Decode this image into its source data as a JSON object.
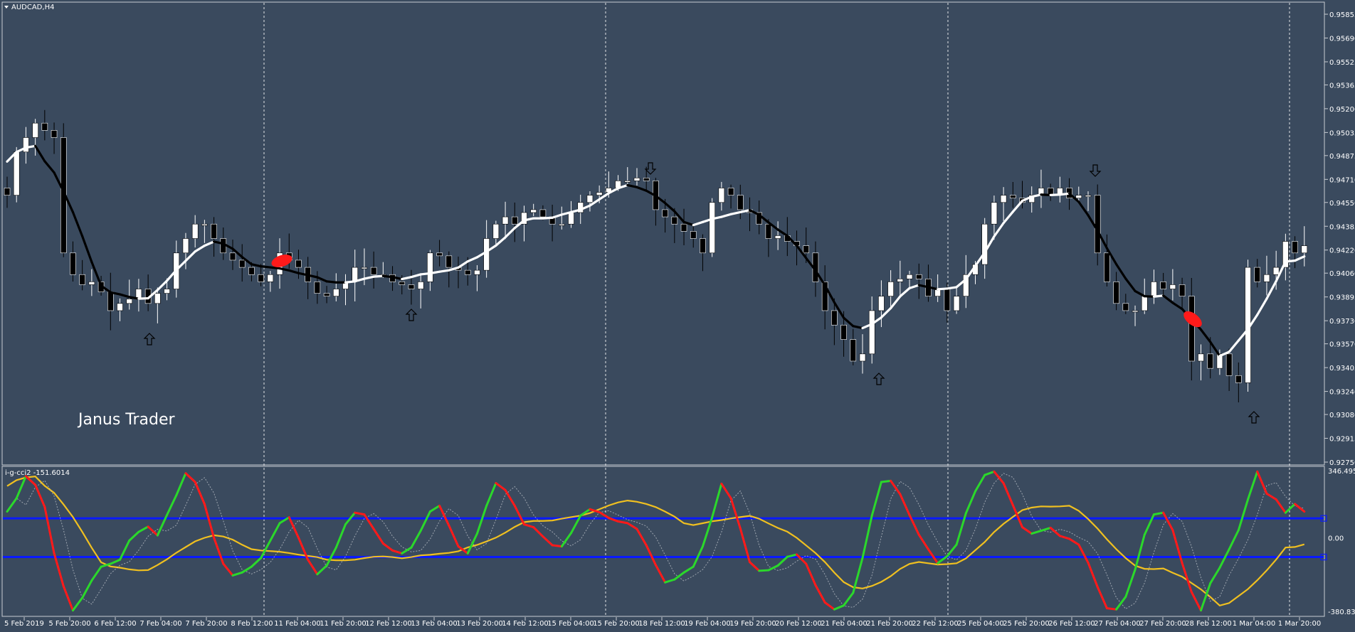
{
  "window": {
    "symbol_label": "AUDCAD,H4",
    "watermark": "Janus Trader",
    "indicator_label": "i-g-cci2 -151.6014"
  },
  "price_axis": {
    "labels": [
      "0.95855",
      "0.95690",
      "0.95525",
      "0.95365",
      "0.95200",
      "0.95035",
      "0.94875",
      "0.94710",
      "0.94550",
      "0.94385",
      "0.94220",
      "0.94060",
      "0.93895",
      "0.93730",
      "0.93570",
      "0.93405",
      "0.93240",
      "0.93080",
      "0.92915",
      "0.92750"
    ]
  },
  "indicator_axis": {
    "labels": [
      "346.4955",
      "0.00",
      "-380.8338"
    ]
  },
  "time_axis": {
    "labels": [
      "5 Feb 2019",
      "5 Feb 20:00",
      "6 Feb 12:00",
      "7 Feb 04:00",
      "7 Feb 20:00",
      "8 Feb 12:00",
      "11 Feb 04:00",
      "11 Feb 20:00",
      "12 Feb 12:00",
      "13 Feb 04:00",
      "13 Feb 20:00",
      "14 Feb 12:00",
      "15 Feb 04:00",
      "15 Feb 20:00",
      "18 Feb 12:00",
      "19 Feb 04:00",
      "19 Feb 20:00",
      "20 Feb 12:00",
      "21 Feb 04:00",
      "21 Feb 20:00",
      "22 Feb 12:00",
      "25 Feb 04:00",
      "25 Feb 20:00",
      "26 Feb 12:00",
      "27 Feb 04:00",
      "27 Feb 20:00",
      "28 Feb 12:00",
      "1 Mar 04:00",
      "1 Mar 20:00"
    ]
  },
  "chart_data": {
    "type": "candlestick",
    "symbol": "AUDCAD",
    "timeframe": "H4",
    "ylim": [
      0.9275,
      0.95855
    ],
    "closes": [
      0.946,
      0.949,
      0.95,
      0.951,
      0.9505,
      0.95,
      0.942,
      0.9405,
      0.9398,
      0.94,
      0.9393,
      0.938,
      0.9385,
      0.9388,
      0.9395,
      0.9385,
      0.9392,
      0.9395,
      0.942,
      0.943,
      0.944,
      0.944,
      0.943,
      0.942,
      0.9415,
      0.941,
      0.9405,
      0.94,
      0.9405,
      0.942,
      0.9415,
      0.941,
      0.94,
      0.9392,
      0.939,
      0.9395,
      0.94,
      0.941,
      0.941,
      0.9405,
      0.9405,
      0.94,
      0.9398,
      0.9395,
      0.94,
      0.942,
      0.9418,
      0.941,
      0.9408,
      0.9405,
      0.9408,
      0.943,
      0.944,
      0.9445,
      0.944,
      0.9448,
      0.945,
      0.9445,
      0.944,
      0.944,
      0.9448,
      0.9455,
      0.946,
      0.9462,
      0.9465,
      0.947,
      0.947,
      0.9472,
      0.947,
      0.945,
      0.9445,
      0.944,
      0.9435,
      0.943,
      0.942,
      0.9455,
      0.9465,
      0.946,
      0.945,
      0.9448,
      0.944,
      0.943,
      0.9432,
      0.9428,
      0.9425,
      0.942,
      0.94,
      0.938,
      0.937,
      0.936,
      0.9345,
      0.935,
      0.938,
      0.939,
      0.94,
      0.9402,
      0.9405,
      0.9402,
      0.939,
      0.9395,
      0.938,
      0.939,
      0.9405,
      0.9412,
      0.944,
      0.9455,
      0.946,
      0.9458,
      0.9455,
      0.946,
      0.9465,
      0.946,
      0.9465,
      0.9458,
      0.946,
      0.946,
      0.942,
      0.94,
      0.9385,
      0.938,
      0.938,
      0.939,
      0.94,
      0.9395,
      0.9398,
      0.939,
      0.9345,
      0.935,
      0.934,
      0.935,
      0.9335,
      0.933,
      0.941,
      0.94,
      0.9405,
      0.941,
      0.9428,
      0.942,
      0.9425
    ],
    "signals": [
      {
        "time": "6 Feb",
        "direction": "up"
      },
      {
        "time": "12 Feb",
        "direction": "up"
      },
      {
        "time": "18 Feb 00:00",
        "direction": "down"
      },
      {
        "time": "21 Feb 08:00",
        "direction": "up"
      },
      {
        "time": "26 Feb",
        "direction": "down"
      },
      {
        "time": "1 Mar 08:00",
        "direction": "up"
      }
    ],
    "indicator": {
      "name": "i-g-cci2",
      "current_value": -151.6014,
      "range": [
        -380.8338,
        346.4955
      ],
      "levels": [
        100,
        -100
      ],
      "colors": {
        "rising": "#2bd82b",
        "falling": "#ff1a1a",
        "slow": "#f0c020",
        "level": "#0a1aff"
      }
    }
  },
  "colors": {
    "background": "#3a4a5e",
    "grid": "#ffffff",
    "bull_candle": "#ffffff",
    "bear_candle": "#000000",
    "ma_up": "#ffffff",
    "ma_down": "#000000",
    "marker": "#ff1a1a"
  }
}
